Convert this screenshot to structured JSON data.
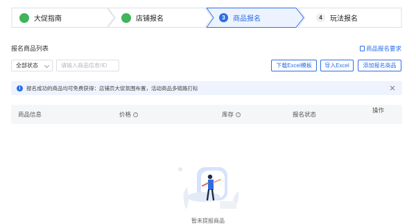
{
  "steps": [
    {
      "label": "大促指南",
      "state": "done"
    },
    {
      "label": "店铺报名",
      "state": "done"
    },
    {
      "label": "商品报名",
      "state": "active",
      "number": "3"
    },
    {
      "label": "玩法报名",
      "state": "idle",
      "number": "4"
    }
  ],
  "list": {
    "title": "报名商品列表",
    "requirements_link": "商品报名要求"
  },
  "filters": {
    "status_selected": "全部状态",
    "search_placeholder": "请输入商品信息/ID"
  },
  "actions": {
    "download_template": "下载Excel模板",
    "import_excel": "导入Excel",
    "add_product": "添加报名商品"
  },
  "notice": {
    "text": "报名成功的商品均可免费获得：店铺页大促氛围布置，活动商品多链路打标"
  },
  "table": {
    "columns": [
      "商品信息",
      "价格",
      "库存",
      "报名状态",
      "操作"
    ]
  },
  "empty": {
    "text": "暂未提报商品"
  },
  "colors": {
    "accent": "#2b6de5",
    "success": "#3fb45a",
    "notice_bg": "#eef3fd",
    "header_bg": "#f5f6f8"
  }
}
